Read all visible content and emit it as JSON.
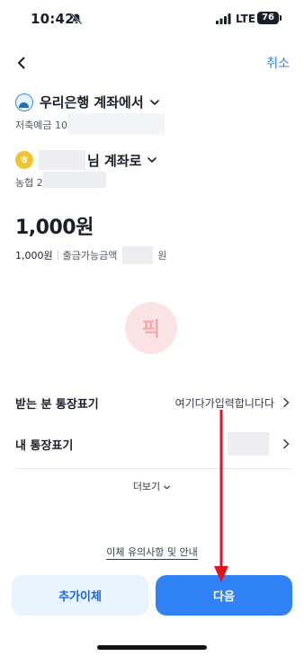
{
  "status_bar": {
    "time": "10:42",
    "network": "LTE",
    "battery": "76"
  },
  "nav": {
    "cancel_label": "취소"
  },
  "from_account": {
    "title": "우리은행 계좌에서",
    "sub_prefix": "저축예금 10"
  },
  "to_account": {
    "logo_letter": "ㅎ",
    "title": "님 계좌로",
    "sub_prefix": "농협 2"
  },
  "amount": {
    "display": "1,000원",
    "sub_amount": "1,000원",
    "available_label": "출금가능금액",
    "available_suffix": "원"
  },
  "watermark": {
    "text": "픽"
  },
  "memo": {
    "receiver_label": "받는 분 통장표기",
    "receiver_value": "여기다가입력합니다다",
    "mine_label": "내 통장표기"
  },
  "more_label": "더보기",
  "notice_link": "이체 유의사항 및 안내",
  "buttons": {
    "additional": "추가이체",
    "next": "다음"
  },
  "colors": {
    "accent": "#3182f6",
    "annotation": "#e0141e"
  }
}
